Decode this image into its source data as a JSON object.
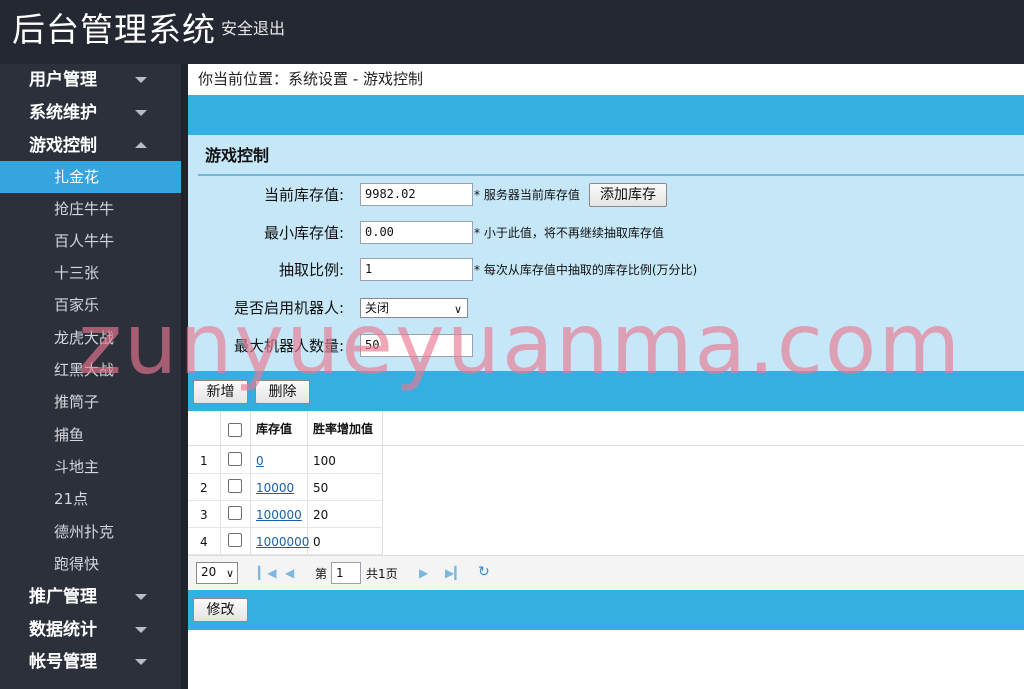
{
  "header": {
    "title": "后台管理系统",
    "logout": "安全退出"
  },
  "sidebar": {
    "groups_top": [
      {
        "label": "用户管理"
      },
      {
        "label": "系统维护"
      },
      {
        "label": "游戏控制"
      }
    ],
    "sub_items": [
      "扎金花",
      "抢庄牛牛",
      "百人牛牛",
      "十三张",
      "百家乐",
      "龙虎大战",
      "红黑大战",
      "推筒子",
      "捕鱼",
      "斗地主",
      "21点",
      "德州扑克",
      "跑得快"
    ],
    "groups_bottom": [
      {
        "label": "推广管理"
      },
      {
        "label": "数据统计"
      },
      {
        "label": "帐号管理"
      }
    ]
  },
  "breadcrumb": {
    "prefix": "你当前位置：",
    "path": "系统设置 - 游戏控制"
  },
  "form": {
    "title": "游戏控制",
    "stock": {
      "label": "当前库存值:",
      "value": "9982.02",
      "hint": "* 服务器当前库存值",
      "button": "添加库存"
    },
    "min_stock": {
      "label": "最小库存值:",
      "value": "0.00",
      "hint": "* 小于此值，将不再继续抽取库存值"
    },
    "ratio": {
      "label": "抽取比例:",
      "value": "1",
      "hint": "* 每次从库存值中抽取的库存比例(万分比)"
    },
    "robot": {
      "label": "是否启用机器人:",
      "value": "关闭"
    },
    "max_robot": {
      "label": "最大机器人数量:",
      "value": "50"
    }
  },
  "toolbar": {
    "add": "新增",
    "delete": "删除"
  },
  "table": {
    "columns": [
      "库存值",
      "胜率增加值"
    ],
    "rows": [
      {
        "index": "1",
        "stock": "0",
        "rate": "100"
      },
      {
        "index": "2",
        "stock": "10000",
        "rate": "50"
      },
      {
        "index": "3",
        "stock": "100000",
        "rate": "20"
      },
      {
        "index": "4",
        "stock": "1000000",
        "rate": "0"
      }
    ]
  },
  "pager": {
    "page_size": "20",
    "page_prefix": "第",
    "page": "1",
    "total": "共1页"
  },
  "footer": {
    "modify": "修改"
  },
  "watermark": "zunyueyuanma.com"
}
